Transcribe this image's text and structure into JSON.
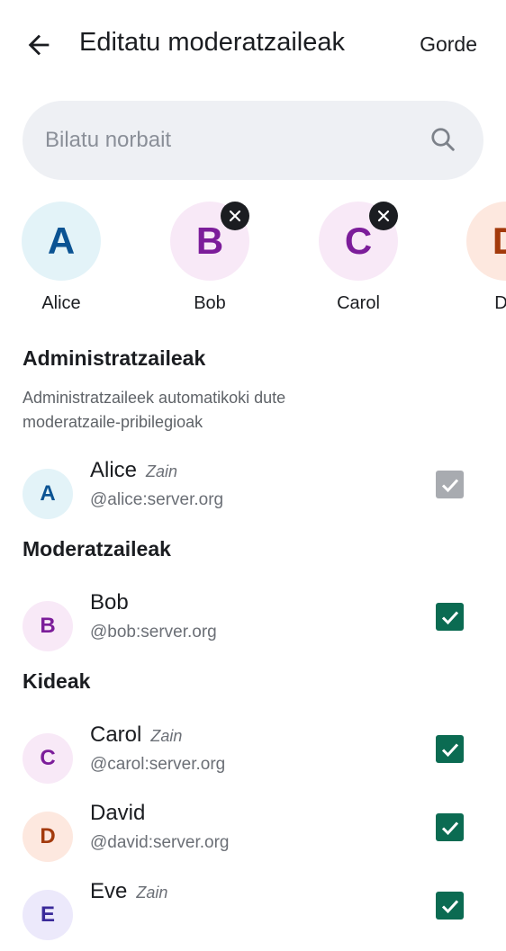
{
  "header": {
    "title": "Editatu moderatzaileak",
    "save_label": "Gorde",
    "back_icon": "arrow-left-icon"
  },
  "search": {
    "placeholder": "Bilatu norbait",
    "value": "",
    "icon": "search-icon"
  },
  "selected_chips": [
    {
      "initial": "A",
      "name": "Alice",
      "bg": "#e3f3f8",
      "fg": "#0b5393",
      "removable": false
    },
    {
      "initial": "B",
      "name": "Bob",
      "bg": "#f8e9f7",
      "fg": "#7c1d9a",
      "removable": true
    },
    {
      "initial": "C",
      "name": "Carol",
      "bg": "#f8e9f7",
      "fg": "#7c1d9a",
      "removable": true
    },
    {
      "initial": "D",
      "name": "Da",
      "bg": "#fde8df",
      "fg": "#a33a0c",
      "removable": false
    }
  ],
  "sections": {
    "admins": {
      "title": "Administratzaileak",
      "description": "Administratzaileek automatikoki dute moderatzaile-pribilegioak"
    },
    "moderators": {
      "title": "Moderatzaileak"
    },
    "members": {
      "title": "Kideak"
    }
  },
  "members": [
    {
      "initial": "A",
      "name": "Alice",
      "tag": "Zain",
      "id": "@alice:server.org",
      "checked": true,
      "disabled": true,
      "bg": "#e3f3f8",
      "fg": "#0b5393"
    },
    {
      "initial": "B",
      "name": "Bob",
      "tag": "",
      "id": "@bob:server.org",
      "checked": true,
      "disabled": false,
      "bg": "#f8e9f7",
      "fg": "#7c1d9a"
    },
    {
      "initial": "C",
      "name": "Carol",
      "tag": "Zain",
      "id": "@carol:server.org",
      "checked": true,
      "disabled": false,
      "bg": "#f8e9f7",
      "fg": "#7c1d9a"
    },
    {
      "initial": "D",
      "name": "David",
      "tag": "",
      "id": "@david:server.org",
      "checked": true,
      "disabled": false,
      "bg": "#fde8df",
      "fg": "#a33a0c"
    },
    {
      "initial": "E",
      "name": "Eve",
      "tag": "Zain",
      "id": "",
      "checked": true,
      "disabled": false,
      "bg": "#ece9fb",
      "fg": "#3a2a9a"
    }
  ],
  "colors": {
    "checkbox_on": "#0b6b52",
    "checkbox_disabled": "#a8abb0",
    "accent_text": "#1b1d21"
  }
}
